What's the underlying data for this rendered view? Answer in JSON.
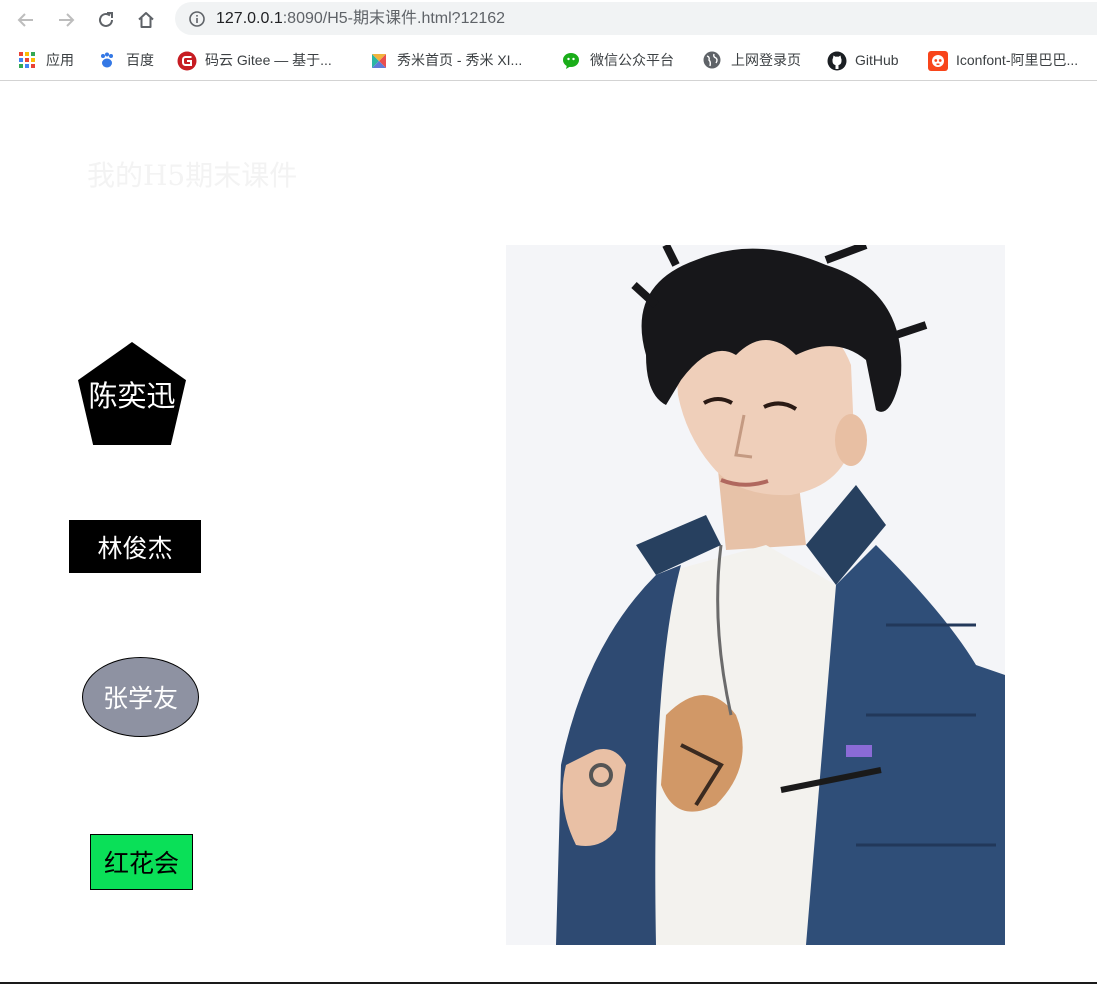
{
  "browser": {
    "url_host": "127.0.0.1",
    "url_rest": ":8090/H5-期末课件.html?12162",
    "nav_icons": [
      "back-arrow-icon",
      "forward-arrow-icon",
      "reload-icon",
      "home-icon",
      "info-icon"
    ]
  },
  "bookmarks": [
    {
      "label": "应用",
      "icon": "apps-grid-icon"
    },
    {
      "label": "百度",
      "icon": "baidu-paw-icon"
    },
    {
      "label": "码云 Gitee — 基于...",
      "icon": "gitee-icon"
    },
    {
      "label": "秀米首页 - 秀米 XI...",
      "icon": "xiumi-icon"
    },
    {
      "label": "微信公众平台",
      "icon": "wechat-icon"
    },
    {
      "label": "上网登录页",
      "icon": "globe-icon"
    },
    {
      "label": "GitHub",
      "icon": "github-icon"
    },
    {
      "label": "Iconfont-阿里巴巴...",
      "icon": "iconfont-icon"
    }
  ],
  "page": {
    "title": "我的H5期末课件",
    "shapes": [
      {
        "label": "陈奕迅",
        "shape": "pentagon",
        "fill": "#000000",
        "text_color": "#ffffff"
      },
      {
        "label": "林俊杰",
        "shape": "rectangle",
        "fill": "#000000",
        "text_color": "#ffffff"
      },
      {
        "label": "张学友",
        "shape": "ellipse",
        "fill": "#8e92a2",
        "text_color": "#ffffff"
      },
      {
        "label": "红花会",
        "shape": "rectangle",
        "fill": "#0ae058",
        "text_color": "#000000"
      }
    ],
    "photo": {
      "alt": "portrait-photo",
      "icon": "portrait-photo"
    }
  },
  "colors": {
    "omnibox_bg": "#f1f3f4",
    "page_bg": "#ffffff",
    "title_color": "#f3f3f3"
  }
}
